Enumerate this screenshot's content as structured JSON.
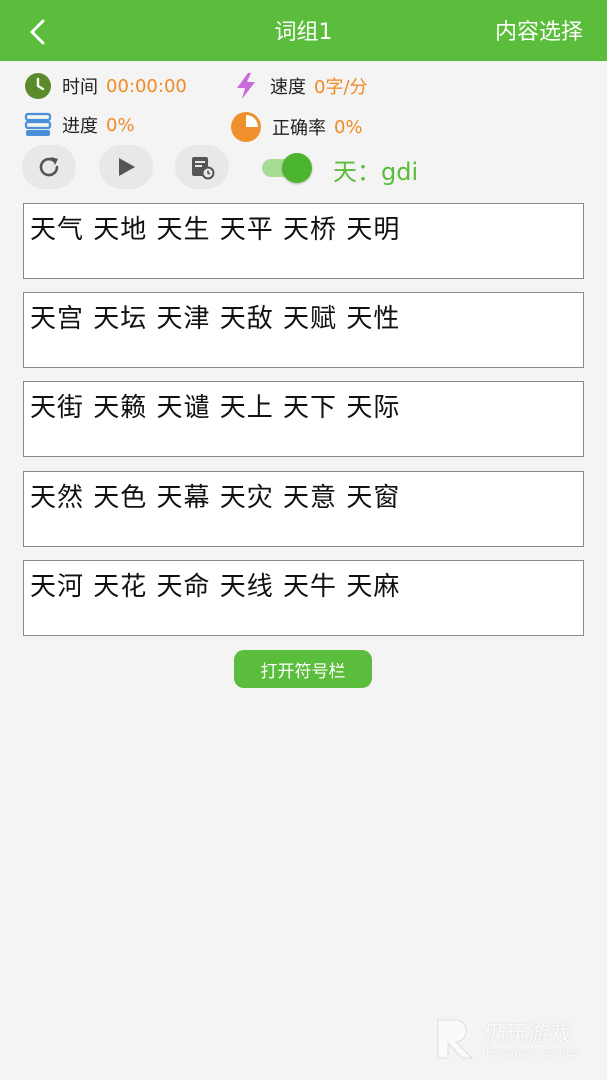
{
  "header": {
    "title": "词组1",
    "content_select": "内容选择"
  },
  "stats": {
    "time_label": "时间",
    "time_value": "00:00:00",
    "speed_label": "速度",
    "speed_value": "0字/分",
    "progress_label": "进度",
    "progress_value": "0%",
    "accuracy_label": "正确率",
    "accuracy_value": "0%"
  },
  "controls": {
    "hint_toggle_on": true,
    "hint_text": "天：gdi"
  },
  "word_rows": [
    "天气 天地 天生 天平 天桥 天明",
    "天宫 天坛 天津 天敌 天赋 天性",
    "天街 天籁 天谴 天上 天下 天际",
    "天然 天色 天幕 天灾 天意 天窗",
    "天河 天花 天命 天线 天牛 天麻"
  ],
  "symbol_bar_button": "打开符号栏",
  "watermark": {
    "title": "仍玩游戏",
    "subtitle": "Rengwan Games"
  },
  "colors": {
    "accent": "#5abd3b",
    "value_orange": "#f08a24",
    "clock": "#5a8a2a",
    "speed": "#c76bd8",
    "progress": "#4a8fd8",
    "accuracy": "#f0902c"
  },
  "icons": {
    "back": "chevron-left-icon",
    "time": "clock-icon",
    "speed": "lightning-icon",
    "progress": "stack-icon",
    "accuracy": "pie-chart-icon",
    "restart": "refresh-icon",
    "play": "play-icon",
    "record": "history-icon"
  }
}
